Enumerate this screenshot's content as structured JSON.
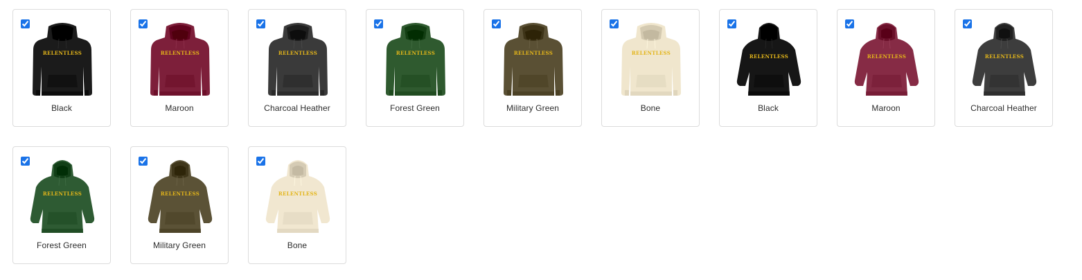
{
  "variants": [
    {
      "label": "Black",
      "color": "#1b1b1b",
      "style": "flat",
      "checked": true,
      "print": "RELENTLESS"
    },
    {
      "label": "Maroon",
      "color": "#7d1f3a",
      "style": "flat",
      "checked": true,
      "print": "RELENTLESS"
    },
    {
      "label": "Charcoal Heather",
      "color": "#3a3a3a",
      "style": "flat",
      "checked": true,
      "print": "RELENTLESS"
    },
    {
      "label": "Forest Green",
      "color": "#2f5a2f",
      "style": "flat",
      "checked": true,
      "print": "RELENTLESS"
    },
    {
      "label": "Military Green",
      "color": "#5a5034",
      "style": "flat",
      "checked": true,
      "print": "RELENTLESS"
    },
    {
      "label": "Bone",
      "color": "#f0e6cd",
      "style": "flat",
      "checked": true,
      "print": "RELENTLESS"
    },
    {
      "label": "Black",
      "color": "#161616",
      "style": "worn",
      "checked": true,
      "print": "RELENTLESS"
    },
    {
      "label": "Maroon",
      "color": "#862b45",
      "style": "worn",
      "checked": true,
      "print": "RELENTLESS"
    },
    {
      "label": "Charcoal Heather",
      "color": "#3d3d3d",
      "style": "worn",
      "checked": true,
      "print": "RELENTLESS"
    },
    {
      "label": "Forest Green",
      "color": "#2e5b33",
      "style": "worn",
      "checked": true,
      "print": "RELENTLESS"
    },
    {
      "label": "Military Green",
      "color": "#5b5236",
      "style": "worn",
      "checked": true,
      "print": "RELENTLESS"
    },
    {
      "label": "Bone",
      "color": "#f1e7d0",
      "style": "worn",
      "checked": true,
      "print": "RELENTLESS"
    }
  ]
}
